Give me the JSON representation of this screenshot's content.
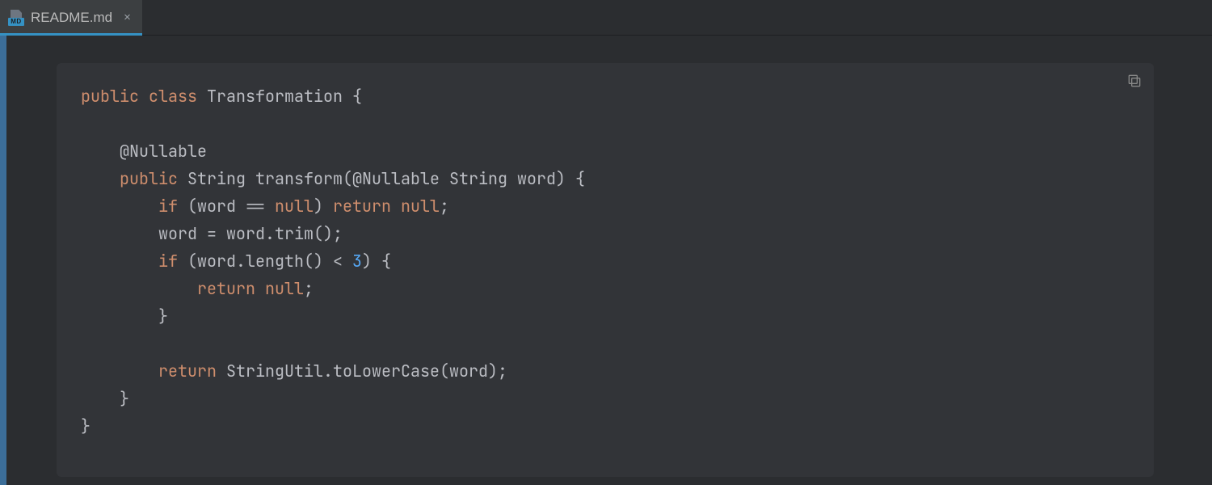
{
  "tab": {
    "filename": "README.md",
    "iconBadge": "MD"
  },
  "code": {
    "lines": [
      {
        "indent": 0,
        "tokens": [
          [
            "k",
            "public"
          ],
          [
            "",
            ". "
          ],
          [
            "k",
            "class"
          ],
          [
            "",
            ". Transformation {"
          ]
        ]
      },
      {
        "indent": 0,
        "tokens": []
      },
      {
        "indent": 1,
        "tokens": [
          [
            "an",
            "@Nullable"
          ]
        ]
      },
      {
        "indent": 1,
        "tokens": [
          [
            "k",
            "public"
          ],
          [
            "",
            ". String transform("
          ],
          [
            "an",
            "@Nullable"
          ],
          [
            "",
            ". String word) {"
          ]
        ]
      },
      {
        "indent": 2,
        "tokens": [
          [
            "k",
            "if"
          ],
          [
            "",
            ". (word == "
          ],
          [
            "kw2",
            "null"
          ],
          [
            "",
            ") "
          ],
          [
            "kw2",
            "return"
          ],
          [
            "",
            ". "
          ],
          [
            "kw2",
            "null"
          ],
          [
            "",
            ";"
          ]
        ]
      },
      {
        "indent": 2,
        "tokens": [
          [
            "",
            "word = word.trim();"
          ]
        ]
      },
      {
        "indent": 2,
        "tokens": [
          [
            "k",
            "if"
          ],
          [
            "",
            ". (word.length() < "
          ],
          [
            "lit",
            "3"
          ],
          [
            "",
            ") {"
          ]
        ]
      },
      {
        "indent": 3,
        "tokens": [
          [
            "kw2",
            "return"
          ],
          [
            "",
            ". "
          ],
          [
            "kw2",
            "null"
          ],
          [
            "",
            ";"
          ]
        ]
      },
      {
        "indent": 2,
        "tokens": [
          [
            "",
            "}"
          ]
        ]
      },
      {
        "indent": 0,
        "tokens": []
      },
      {
        "indent": 2,
        "tokens": [
          [
            "kw2",
            "return"
          ],
          [
            "",
            ". StringUtil.toLowerCase(word);"
          ]
        ]
      },
      {
        "indent": 1,
        "tokens": [
          [
            "",
            "}"
          ]
        ]
      },
      {
        "indent": 0,
        "tokens": [
          [
            "",
            "}"
          ]
        ]
      }
    ]
  }
}
